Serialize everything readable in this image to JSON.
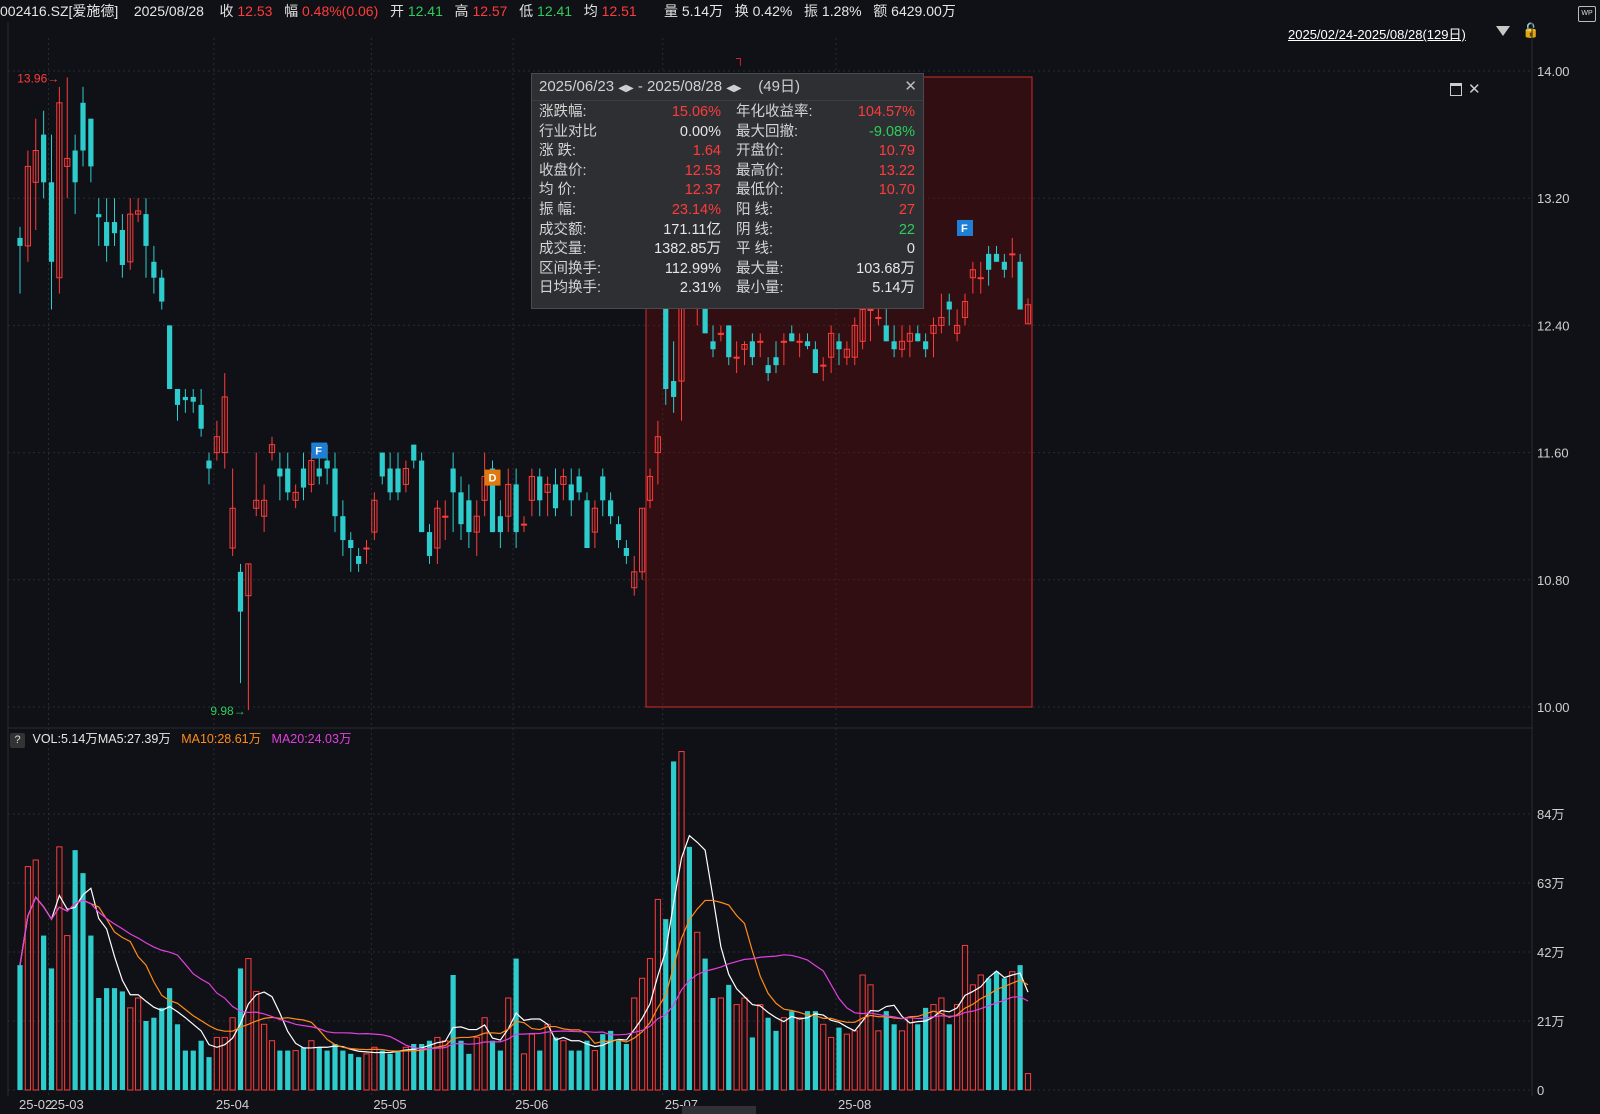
{
  "header": {
    "symbol": "002416.SZ[爱施德]",
    "date": "2025/08/28",
    "close_label": "收",
    "close": "12.53",
    "change_label": "幅",
    "change": "0.48%(0.06)",
    "open_label": "开",
    "open": "12.41",
    "high_label": "高",
    "high": "12.57",
    "low_label": "低",
    "low": "12.41",
    "avg_label": "均",
    "avg": "12.51",
    "vol_label": "量",
    "vol": "5.14万",
    "turn_label": "换",
    "turn": "0.42%",
    "amp_label": "振",
    "amp": "1.28%",
    "amt_label": "额",
    "amt": "6429.00万"
  },
  "range_selector": {
    "label": "2025/02/24-2025/08/28(129日)"
  },
  "popup": {
    "start": "2025/06/23",
    "sep": "-",
    "end": "2025/08/28",
    "days": "(49日)",
    "rows": [
      {
        "k1": "涨跌幅:",
        "v1": "15.06%",
        "c1": "#ff3b3b",
        "k2": "年化收益率:",
        "v2": "104.57%",
        "c2": "#ff3b3b"
      },
      {
        "k1": "行业对比",
        "v1": "0.00%",
        "c1": "#e6e6e6",
        "k2": "最大回撤:",
        "v2": "-9.08%",
        "c2": "#2ecc5a"
      },
      {
        "k1": "涨  跌:",
        "v1": "1.64",
        "c1": "#ff3b3b",
        "k2": "开盘价:",
        "v2": "10.79",
        "c2": "#ff3b3b"
      },
      {
        "k1": "收盘价:",
        "v1": "12.53",
        "c1": "#ff3b3b",
        "k2": "最高价:",
        "v2": "13.22",
        "c2": "#ff3b3b"
      },
      {
        "k1": "均  价:",
        "v1": "12.37",
        "c1": "#ff3b3b",
        "k2": "最低价:",
        "v2": "10.70",
        "c2": "#ff3b3b"
      },
      {
        "k1": "振  幅:",
        "v1": "23.14%",
        "c1": "#ff3b3b",
        "k2": "阳  线:",
        "v2": "27",
        "c2": "#ff3b3b"
      },
      {
        "k1": "成交额:",
        "v1": "171.11亿",
        "c1": "#e6e6e6",
        "k2": "阴  线:",
        "v2": "22",
        "c2": "#2ecc5a"
      },
      {
        "k1": "成交量:",
        "v1": "1382.85万",
        "c1": "#e6e6e6",
        "k2": "平  线:",
        "v2": "0",
        "c2": "#e6e6e6"
      },
      {
        "k1": "区间换手:",
        "v1": "112.99%",
        "c1": "#e6e6e6",
        "k2": "最大量:",
        "v2": "103.68万",
        "c2": "#e6e6e6"
      },
      {
        "k1": "日均换手:",
        "v1": "2.31%",
        "c1": "#e6e6e6",
        "k2": "最小量:",
        "v2": "5.14万",
        "c2": "#e6e6e6"
      }
    ]
  },
  "vol_legend": {
    "help": "?",
    "vol": "VOL:5.14万",
    "ma5": "MA5:27.39万",
    "ma10": "MA10:28.61万",
    "ma20": "MA20:24.03万"
  },
  "colors": {
    "up": "#ff3b3b",
    "down": "#2ecccc",
    "ma5": "#ffffff",
    "ma10": "#ff8c1a",
    "ma20": "#e040e0",
    "grid": "#2a2b30"
  },
  "chart_data": {
    "type": "candlestick",
    "price_axis": {
      "ticks": [
        "14.00",
        "13.20",
        "12.40",
        "11.60",
        "10.80",
        "10.00"
      ],
      "values": [
        14.0,
        13.2,
        12.4,
        11.6,
        10.8,
        10.0
      ],
      "range": [
        10.0,
        14.0
      ]
    },
    "volume_axis": {
      "ticks": [
        "84万",
        "63万",
        "42万",
        "21万",
        "0"
      ],
      "values": [
        84,
        63,
        42,
        21,
        0
      ],
      "range": [
        0,
        105
      ]
    },
    "x_labels": [
      {
        "label": "25-02",
        "index": 0
      },
      {
        "label": "25-03",
        "index": 4
      },
      {
        "label": "25-04",
        "index": 25
      },
      {
        "label": "25-05",
        "index": 45
      },
      {
        "label": "25-06",
        "index": 63
      },
      {
        "label": "25-07",
        "index": 82
      },
      {
        "label": "25-08",
        "index": 104
      }
    ],
    "annotations": {
      "max_label": "13.96",
      "max_index": 6,
      "min_label": "9.98",
      "min_index": 29,
      "markers": [
        {
          "text": "F",
          "index": 38,
          "price": 11.55,
          "color": "#1f7fd6"
        },
        {
          "text": "D",
          "index": 60,
          "price": 11.38,
          "color": "#e07a10"
        },
        {
          "text": "F",
          "index": 120,
          "price": 12.95,
          "color": "#1f7fd6"
        }
      ],
      "selection": {
        "from_index": 80,
        "to_index": 128
      }
    },
    "candles": [
      [
        12.95,
        13.02,
        12.6,
        12.9,
        38
      ],
      [
        12.9,
        13.5,
        12.8,
        13.4,
        68
      ],
      [
        13.3,
        13.7,
        13.0,
        13.5,
        70
      ],
      [
        13.6,
        13.75,
        13.2,
        13.3,
        47
      ],
      [
        13.3,
        13.6,
        12.5,
        12.8,
        37
      ],
      [
        12.7,
        13.9,
        12.6,
        13.8,
        74
      ],
      [
        13.4,
        13.96,
        13.2,
        13.45,
        47
      ],
      [
        13.5,
        13.6,
        13.1,
        13.3,
        73
      ],
      [
        13.8,
        13.9,
        13.4,
        13.5,
        66
      ],
      [
        13.7,
        13.7,
        13.3,
        13.4,
        47
      ],
      [
        13.1,
        13.2,
        12.9,
        13.08,
        28
      ],
      [
        13.05,
        13.2,
        12.8,
        12.9,
        31
      ],
      [
        13.05,
        13.2,
        12.9,
        12.98,
        31
      ],
      [
        13.0,
        13.1,
        12.7,
        12.78,
        30
      ],
      [
        12.8,
        13.2,
        12.75,
        13.1,
        25
      ],
      [
        13.1,
        13.2,
        13.05,
        13.12,
        28
      ],
      [
        13.1,
        13.2,
        12.7,
        12.9,
        21
      ],
      [
        12.8,
        12.9,
        12.6,
        12.7,
        22
      ],
      [
        12.7,
        12.75,
        12.5,
        12.55,
        25
      ],
      [
        12.4,
        12.4,
        12.0,
        12.0,
        31
      ],
      [
        12.0,
        12.0,
        11.8,
        11.9,
        20
      ],
      [
        11.95,
        12.0,
        11.85,
        11.93,
        12
      ],
      [
        11.95,
        12.0,
        11.85,
        11.92,
        12
      ],
      [
        11.9,
        12.0,
        11.7,
        11.75,
        15
      ],
      [
        11.55,
        11.6,
        11.4,
        11.5,
        10
      ],
      [
        11.6,
        11.8,
        11.55,
        11.7,
        16
      ],
      [
        11.6,
        12.1,
        11.5,
        11.95,
        16
      ],
      [
        11.0,
        11.5,
        10.95,
        11.25,
        22
      ],
      [
        10.85,
        10.9,
        10.15,
        10.6,
        37
      ],
      [
        10.7,
        10.9,
        9.98,
        10.9,
        40
      ],
      [
        11.25,
        11.6,
        11.2,
        11.3,
        30
      ],
      [
        11.2,
        11.4,
        11.1,
        11.3,
        20
      ],
      [
        11.6,
        11.7,
        11.55,
        11.65,
        15
      ],
      [
        11.5,
        11.6,
        11.3,
        11.45,
        12
      ],
      [
        11.5,
        11.6,
        11.3,
        11.35,
        12
      ],
      [
        11.3,
        11.4,
        11.25,
        11.35,
        12
      ],
      [
        11.5,
        11.6,
        11.3,
        11.38,
        13
      ],
      [
        11.4,
        11.6,
        11.35,
        11.55,
        15
      ],
      [
        11.5,
        11.6,
        11.4,
        11.45,
        13
      ],
      [
        11.55,
        11.65,
        11.4,
        11.5,
        12
      ],
      [
        11.5,
        11.6,
        11.1,
        11.2,
        14
      ],
      [
        11.2,
        11.3,
        10.95,
        11.05,
        12
      ],
      [
        11.05,
        11.1,
        10.85,
        11.0,
        11
      ],
      [
        10.95,
        11.0,
        10.85,
        10.9,
        10
      ],
      [
        11.0,
        11.05,
        10.9,
        11.0,
        11
      ],
      [
        11.1,
        11.35,
        11.05,
        11.3,
        13
      ],
      [
        11.6,
        11.6,
        11.4,
        11.45,
        12
      ],
      [
        11.5,
        11.6,
        11.3,
        11.35,
        11
      ],
      [
        11.5,
        11.6,
        11.3,
        11.35,
        12
      ],
      [
        11.4,
        11.55,
        11.35,
        11.5,
        13
      ],
      [
        11.65,
        11.65,
        11.5,
        11.55,
        14
      ],
      [
        11.55,
        11.6,
        11.1,
        11.1,
        14
      ],
      [
        11.1,
        11.15,
        10.9,
        10.95,
        15
      ],
      [
        11.0,
        11.3,
        10.9,
        11.25,
        16
      ],
      [
        11.2,
        11.3,
        11.05,
        11.2,
        15
      ],
      [
        11.5,
        11.6,
        11.1,
        11.35,
        35
      ],
      [
        11.35,
        11.45,
        11.05,
        11.15,
        15
      ],
      [
        11.3,
        11.4,
        11.0,
        11.1,
        11
      ],
      [
        11.1,
        11.3,
        10.95,
        11.2,
        16
      ],
      [
        11.3,
        11.6,
        11.2,
        11.45,
        22
      ],
      [
        11.5,
        11.55,
        11.1,
        11.1,
        15
      ],
      [
        11.2,
        11.3,
        11.0,
        11.1,
        12
      ],
      [
        11.2,
        11.5,
        11.1,
        11.4,
        28
      ],
      [
        11.4,
        11.5,
        11.0,
        11.1,
        40
      ],
      [
        11.15,
        11.2,
        11.1,
        11.15,
        11
      ],
      [
        11.3,
        11.5,
        11.2,
        11.45,
        17
      ],
      [
        11.45,
        11.5,
        11.2,
        11.3,
        12
      ],
      [
        11.35,
        11.45,
        11.2,
        11.4,
        20
      ],
      [
        11.4,
        11.5,
        11.2,
        11.25,
        16
      ],
      [
        11.4,
        11.5,
        11.3,
        11.45,
        15
      ],
      [
        11.4,
        11.5,
        11.2,
        11.3,
        12
      ],
      [
        11.45,
        11.5,
        11.3,
        11.35,
        12
      ],
      [
        11.3,
        11.35,
        11.0,
        11.0,
        15
      ],
      [
        11.1,
        11.3,
        11.0,
        11.25,
        12
      ],
      [
        11.45,
        11.5,
        11.2,
        11.3,
        17
      ],
      [
        11.3,
        11.35,
        11.15,
        11.2,
        18
      ],
      [
        11.15,
        11.2,
        11.0,
        11.05,
        15
      ],
      [
        11.0,
        11.05,
        10.9,
        10.95,
        14
      ],
      [
        10.75,
        10.95,
        10.7,
        10.85,
        28
      ],
      [
        10.85,
        11.25,
        10.8,
        11.25,
        34
      ],
      [
        11.3,
        11.5,
        11.25,
        11.45,
        40
      ],
      [
        11.6,
        11.8,
        11.4,
        11.7,
        58
      ],
      [
        12.55,
        12.7,
        11.9,
        12.0,
        52
      ],
      [
        12.05,
        12.3,
        11.85,
        11.95,
        100
      ],
      [
        12.05,
        13.22,
        11.8,
        13.22,
        103
      ],
      [
        12.9,
        12.9,
        12.6,
        12.6,
        74
      ],
      [
        12.6,
        12.7,
        12.4,
        12.6,
        48
      ],
      [
        12.55,
        12.6,
        12.35,
        12.35,
        40
      ],
      [
        12.3,
        12.4,
        12.2,
        12.25,
        28
      ],
      [
        12.35,
        12.4,
        12.3,
        12.35,
        28
      ],
      [
        12.4,
        12.4,
        12.15,
        12.2,
        32
      ],
      [
        12.2,
        12.3,
        12.1,
        12.2,
        26
      ],
      [
        12.25,
        12.3,
        12.15,
        12.28,
        28
      ],
      [
        12.3,
        12.35,
        12.15,
        12.2,
        16
      ],
      [
        12.3,
        12.35,
        12.2,
        12.3,
        26
      ],
      [
        12.15,
        12.2,
        12.05,
        12.1,
        22
      ],
      [
        12.2,
        12.3,
        12.1,
        12.15,
        18
      ],
      [
        12.3,
        12.35,
        12.15,
        12.3,
        22
      ],
      [
        12.35,
        12.4,
        12.3,
        12.3,
        24
      ],
      [
        12.3,
        12.35,
        12.2,
        12.3,
        22
      ],
      [
        12.3,
        12.35,
        12.25,
        12.27,
        24
      ],
      [
        12.25,
        12.3,
        12.1,
        12.1,
        24
      ],
      [
        12.15,
        12.2,
        12.05,
        12.15,
        20
      ],
      [
        12.2,
        12.4,
        12.1,
        12.35,
        16
      ],
      [
        12.3,
        12.35,
        12.15,
        12.25,
        19
      ],
      [
        12.2,
        12.3,
        12.15,
        12.25,
        17
      ],
      [
        12.2,
        12.45,
        12.15,
        12.4,
        18
      ],
      [
        12.3,
        12.7,
        12.25,
        12.5,
        35
      ],
      [
        12.5,
        12.65,
        12.3,
        12.5,
        32
      ],
      [
        12.45,
        12.65,
        12.4,
        12.45,
        18
      ],
      [
        12.4,
        12.6,
        12.3,
        12.3,
        24
      ],
      [
        12.3,
        12.4,
        12.2,
        12.25,
        20
      ],
      [
        12.25,
        12.4,
        12.2,
        12.3,
        18
      ],
      [
        12.3,
        12.4,
        12.2,
        12.35,
        22
      ],
      [
        12.35,
        12.4,
        12.3,
        12.3,
        20
      ],
      [
        12.3,
        12.35,
        12.2,
        12.25,
        25
      ],
      [
        12.35,
        12.45,
        12.2,
        12.4,
        26
      ],
      [
        12.4,
        12.6,
        12.35,
        12.45,
        28
      ],
      [
        12.55,
        12.6,
        12.4,
        12.5,
        20
      ],
      [
        12.35,
        12.5,
        12.3,
        12.4,
        26
      ],
      [
        12.45,
        12.6,
        12.4,
        12.55,
        44
      ],
      [
        12.7,
        12.8,
        12.6,
        12.75,
        32
      ],
      [
        12.7,
        12.8,
        12.6,
        12.7,
        35
      ],
      [
        12.85,
        12.9,
        12.65,
        12.75,
        34
      ],
      [
        12.85,
        12.9,
        12.8,
        12.8,
        36
      ],
      [
        12.8,
        12.85,
        12.7,
        12.75,
        34
      ],
      [
        12.85,
        12.95,
        12.7,
        12.85,
        36
      ],
      [
        12.8,
        12.85,
        12.5,
        12.5,
        38
      ],
      [
        12.41,
        12.57,
        12.41,
        12.53,
        5
      ]
    ]
  }
}
